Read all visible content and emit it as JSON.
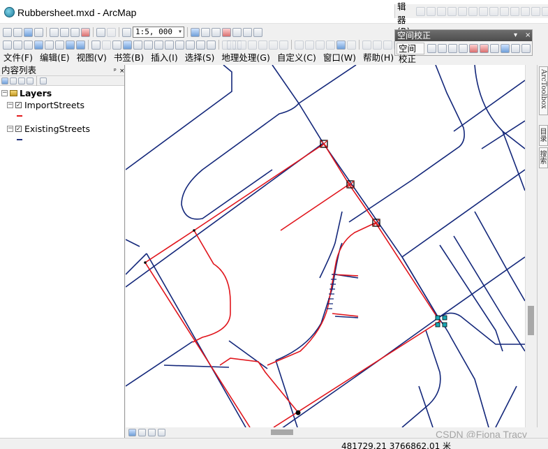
{
  "window": {
    "title": "Rubbersheet.mxd - ArcMap"
  },
  "toolbar": {
    "scale_value": "1:5, 000"
  },
  "editor_toolbar": {
    "label": "编辑器(R)·"
  },
  "menu": {
    "items": [
      {
        "label": "文件(F)"
      },
      {
        "label": "编辑(E)"
      },
      {
        "label": "视图(V)"
      },
      {
        "label": "书签(B)"
      },
      {
        "label": "插入(I)"
      },
      {
        "label": "选择(S)"
      },
      {
        "label": "地理处理(G)"
      },
      {
        "label": "自定义(C)"
      },
      {
        "label": "窗口(W)"
      },
      {
        "label": "帮助(H)"
      }
    ]
  },
  "spatial_adjustment": {
    "panel_title": "空间校正",
    "menu_label": "空间校正(J)·",
    "close": "×",
    "dropdown": "▾"
  },
  "toc": {
    "title": "内容列表",
    "pin": "ᵖ",
    "close": "×",
    "root_label": "Layers",
    "layers": [
      {
        "label": "ImportStreets",
        "color": "#e31a1c"
      },
      {
        "label": "ExistingStreets",
        "color": "#1f2f7a"
      }
    ]
  },
  "side_dock": {
    "toolbox_label": "ArcToolbox",
    "catalog_label": "目录",
    "search_label": "搜索"
  },
  "map": {
    "existing_color": "#13277a",
    "import_color": "#e0141b",
    "link_color": "#d41e1e",
    "selected_color": "#1aa7b5"
  },
  "status": {
    "coordinates": "481729.21 3766862.01 米"
  },
  "watermark": "CSDN @Fiona Tracy"
}
